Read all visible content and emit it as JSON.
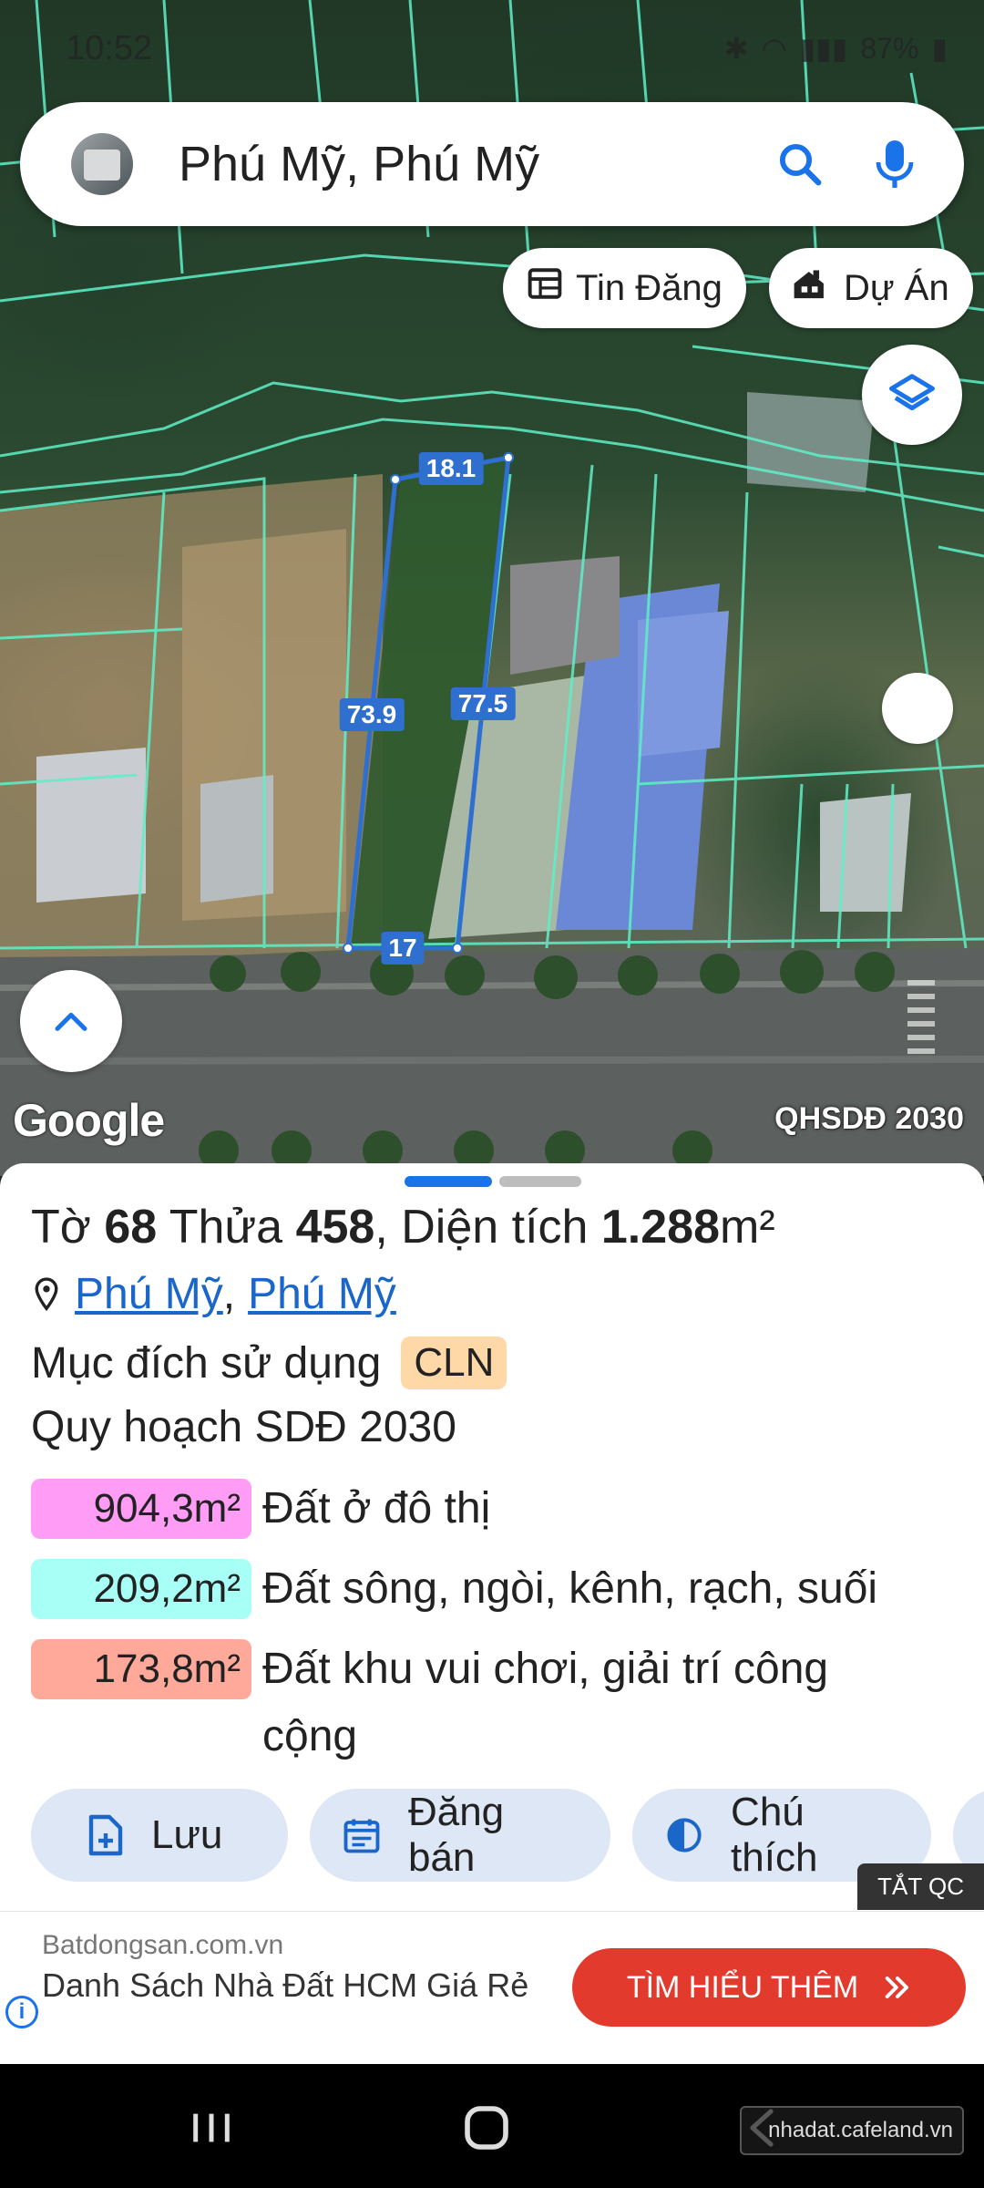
{
  "status_bar": {
    "time": "10:52",
    "battery": "87%"
  },
  "search": {
    "query": "Phú Mỹ, Phú Mỹ"
  },
  "chips": {
    "listings": "Tin Đăng",
    "projects": "Dự Án"
  },
  "map": {
    "google_logo": "Google",
    "overlay_label": "QHSDĐ 2030",
    "dimensions": {
      "top": "18.1",
      "left": "73.9",
      "right": "77.5",
      "bottom": "17"
    }
  },
  "parcel": {
    "to_label": "Tờ",
    "to_value": "68",
    "thua_label": "Thửa",
    "thua_value": "458",
    "area_label": ", Diện tích",
    "area_value": "1.288",
    "area_unit": "m²",
    "location_ward": "Phú Mỹ",
    "location_separator": ",",
    "location_district": "Phú Mỹ",
    "purpose_label": "Mục đích sử dụng",
    "purpose_code": "CLN",
    "plan_label": "Quy hoạch SDĐ 2030"
  },
  "zones": [
    {
      "area": "904,3m²",
      "label": "Đất ở đô thị",
      "color": "#ff9cf5"
    },
    {
      "area": "209,2m²",
      "label": "Đất sông, ngòi, kênh, rạch, suối",
      "color": "#a8fff6"
    },
    {
      "area": "173,8m²",
      "label": "Đất khu vui chơi, giải trí công cộng",
      "color": "#ffa99a"
    }
  ],
  "actions": {
    "save": "Lưu",
    "post_sale": "Đăng bán",
    "legend": "Chú thích"
  },
  "ad": {
    "close_label": "TẮT QC",
    "source": "Batdongsan.com.vn",
    "title": "Danh Sách Nhà Đất HCM Giá Rẻ",
    "cta": "TÌM HIỂU THÊM",
    "info": "i"
  },
  "watermark": "nhadat.cafeland.vn",
  "colors": {
    "accent": "#1a73e8",
    "parcel_line": "#2f6fd0",
    "cadastre_line": "#5ff0c8",
    "cta": "#e23b2e"
  }
}
